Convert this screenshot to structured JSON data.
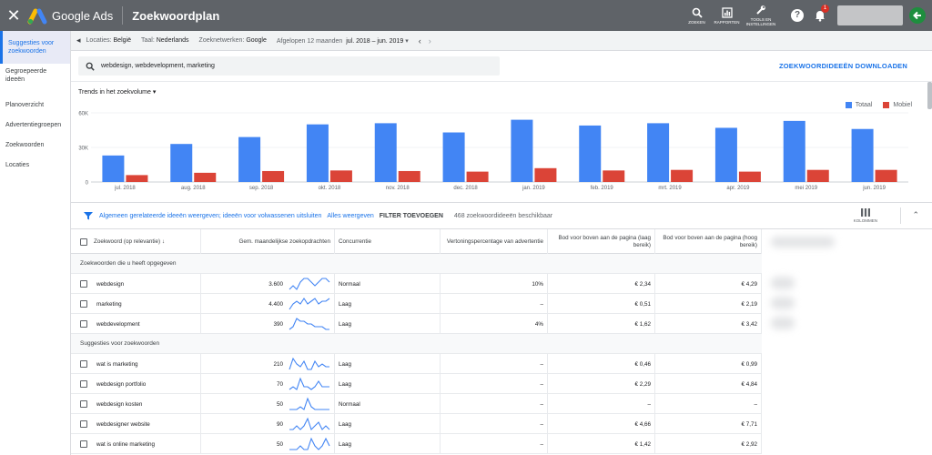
{
  "topbar": {
    "brand": "Google Ads",
    "title": "Zoekwoordplan",
    "tools": [
      {
        "icon": "search-icon",
        "label": "ZOEKEN"
      },
      {
        "icon": "reports-icon",
        "label": "RAPPORTEN"
      },
      {
        "icon": "tools-icon",
        "label": "TOOLS EN INSTELLINGEN"
      }
    ],
    "notification_count": "1"
  },
  "sidebar": {
    "items": [
      {
        "label": "Suggesties voor zoekwoorden",
        "active": true
      },
      {
        "label": "Gegroepeerde ideeën",
        "active": false
      },
      {
        "label": "Planoverzicht",
        "active": false
      },
      {
        "label": "Advertentiegroepen",
        "active": false
      },
      {
        "label": "Zoekwoorden",
        "active": false
      },
      {
        "label": "Locaties",
        "active": false
      }
    ]
  },
  "filters": {
    "locations_label": "Locaties:",
    "locations_value": "België",
    "language_label": "Taal:",
    "language_value": "Nederlands",
    "network_label": "Zoeknetwerken:",
    "network_value": "Google",
    "period_label": "Afgelopen 12 maanden",
    "period_value": "jul. 2018 – jun. 2019"
  },
  "search": {
    "query": "webdesign, webdevelopment, marketing",
    "download_label": "ZOEKWOORDIDEEËN DOWNLOADEN"
  },
  "chart_data": {
    "type": "bar",
    "title": "Trends in het zoekvolume",
    "categories": [
      "jul. 2018",
      "aug. 2018",
      "sep. 2018",
      "okt. 2018",
      "nov. 2018",
      "dec. 2018",
      "jan. 2019",
      "feb. 2019",
      "mrt. 2019",
      "apr. 2019",
      "mei 2019",
      "jun. 2019"
    ],
    "series": [
      {
        "name": "Totaal",
        "color": "#4285f4",
        "values": [
          23000,
          33000,
          39000,
          50000,
          51000,
          43000,
          54000,
          49000,
          51000,
          47000,
          53000,
          46000
        ]
      },
      {
        "name": "Mobiel",
        "color": "#db4437",
        "values": [
          6000,
          8000,
          9500,
          10000,
          9500,
          9000,
          12000,
          10000,
          10500,
          9000,
          10500,
          10500
        ]
      }
    ],
    "yticks": [
      "0",
      "30K",
      "60K"
    ],
    "ylim": [
      0,
      60000
    ],
    "legend": "top-right"
  },
  "filter_strip": {
    "link1": "Algemeen gerelateerde ideeën weergeven; ideeën voor volwassenen uitsluiten",
    "link2": "Alles weergeven",
    "add_filter": "FILTER TOEVOEGEN",
    "count": "468 zoekwoordideeën beschikbaar",
    "columns_label": "KOLOMMEN"
  },
  "table": {
    "headers": [
      "Zoekwoord (op relevantie)",
      "Gem. maandelijkse zoekopdrachten",
      "Concurrentie",
      "Vertoningspercentage van advertentie",
      "Bod voor boven aan de pagina (laag bereik)",
      "Bod voor boven aan de pagina (hoog bereik)"
    ],
    "sections": [
      {
        "title": "Zoekwoorden die u heeft opgegeven",
        "rows": [
          {
            "keyword": "webdesign",
            "searches": "3.600",
            "competition": "Normaal",
            "impression_share": "10%",
            "bid_low": "€ 2,34",
            "bid_high": "€ 4,29",
            "trend": [
              3,
              4,
              3,
              5,
              6,
              6,
              5,
              4,
              5,
              6,
              6,
              5
            ]
          },
          {
            "keyword": "marketing",
            "searches": "4.400",
            "competition": "Laag",
            "impression_share": "–",
            "bid_low": "€ 0,51",
            "bid_high": "€ 2,19",
            "trend": [
              2,
              4,
              5,
              4,
              6,
              4,
              5,
              6,
              4,
              5,
              5,
              6
            ]
          },
          {
            "keyword": "webdevelopment",
            "searches": "390",
            "competition": "Laag",
            "impression_share": "4%",
            "bid_low": "€ 1,62",
            "bid_high": "€ 3,42",
            "trend": [
              2,
              3,
              6,
              5,
              5,
              4,
              4,
              3,
              3,
              3,
              2,
              2
            ]
          }
        ]
      },
      {
        "title": "Suggesties voor zoekwoorden",
        "rows": [
          {
            "keyword": "wat is marketing",
            "searches": "210",
            "competition": "Laag",
            "impression_share": "–",
            "bid_low": "€ 0,46",
            "bid_high": "€ 0,99",
            "trend": [
              2,
              6,
              4,
              3,
              5,
              2,
              2,
              5,
              3,
              4,
              3,
              3
            ]
          },
          {
            "keyword": "webdesign portfolio",
            "searches": "70",
            "competition": "Laag",
            "impression_share": "–",
            "bid_low": "€ 2,29",
            "bid_high": "€ 4,84",
            "trend": [
              2,
              3,
              2,
              6,
              3,
              3,
              2,
              3,
              5,
              3,
              3,
              3
            ]
          },
          {
            "keyword": "webdesign kosten",
            "searches": "50",
            "competition": "Normaal",
            "impression_share": "–",
            "bid_low": "–",
            "bid_high": "–",
            "trend": [
              2,
              2,
              2,
              3,
              2,
              6,
              3,
              2,
              2,
              2,
              2,
              2
            ]
          },
          {
            "keyword": "webdesigner website",
            "searches": "90",
            "competition": "Laag",
            "impression_share": "–",
            "bid_low": "€ 4,66",
            "bid_high": "€ 7,71",
            "trend": [
              2,
              2,
              3,
              2,
              3,
              5,
              2,
              3,
              4,
              2,
              3,
              2
            ]
          },
          {
            "keyword": "wat is online marketing",
            "searches": "50",
            "competition": "Laag",
            "impression_share": "–",
            "bid_low": "€ 1,42",
            "bid_high": "€ 2,92",
            "trend": [
              2,
              2,
              2,
              3,
              2,
              2,
              5,
              3,
              2,
              3,
              5,
              3
            ]
          }
        ]
      }
    ]
  }
}
